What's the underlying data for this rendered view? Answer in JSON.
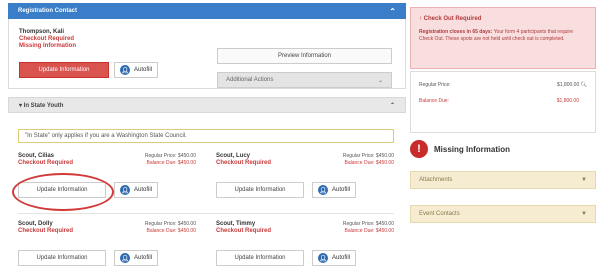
{
  "contact": {
    "header": "Registration Contact",
    "name": "Thompson, Kali",
    "status1": "Checkout Required",
    "status2": "Missing Information",
    "update_button": "Update Information",
    "autofill_label": "Autofill",
    "preview_button": "Preview Information",
    "additional_actions": "Additional Actions"
  },
  "group": {
    "header": "In State Youth",
    "note": "\"In State\" only applies if you are a Washington State Council.",
    "regular_price_label": "Regular Price:",
    "balance_due_label": "Balance Due:",
    "people": [
      {
        "name": "Scout, Cilias",
        "status": "Checkout Required",
        "regular_price": "$450.00",
        "balance_due": "$450.00",
        "update_label": "Update Information",
        "autofill_label": "Autofill"
      },
      {
        "name": "Scout, Lucy",
        "status": "Checkout Required",
        "regular_price": "$450.00",
        "balance_due": "$450.00",
        "update_label": "Update Information",
        "autofill_label": "Autofill"
      },
      {
        "name": "Scout, Dolly",
        "status": "Checkout Required",
        "regular_price": "$450.00",
        "balance_due": "$450.00",
        "update_label": "Update Information",
        "autofill_label": "Autofill"
      },
      {
        "name": "Scout, Timmy",
        "status": "Checkout Required",
        "regular_price": "$450.00",
        "balance_due": "$450.00",
        "update_label": "Update Information",
        "autofill_label": "Autofill"
      }
    ]
  },
  "alert": {
    "title": "Check Out Required",
    "body_bold": "Registration closes in 65 days:",
    "body": "Your form 4 participants that require Check Out. These spots are not held until check out is completed."
  },
  "summary": {
    "regular_label": "Regular Price:",
    "regular_value": "$1,800.00",
    "balance_label": "Balance Due:",
    "balance_value": "$1,800.00"
  },
  "missing": {
    "title": "Missing Information",
    "items": [
      "Attachments",
      "Event Contacts"
    ]
  },
  "colors": {
    "header_blue": "#3a7dc9",
    "update_red": "#d9534f",
    "alert_bg": "#f8dede",
    "accordion_bg": "#f5ecd2",
    "highlight_circle": "#d23a3a"
  }
}
